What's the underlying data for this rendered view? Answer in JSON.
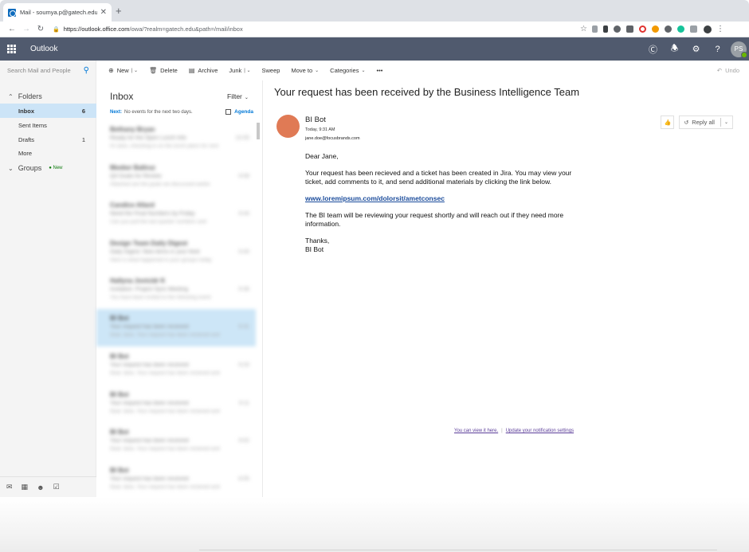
{
  "browser": {
    "tab_title": "Mail - soumya.p@gatech.edu",
    "tab_close": "✕",
    "new_tab": "+",
    "url_host": "https://outlook.office.com",
    "url_path": "/owa/?realm=gatech.edu&path=/mail/inbox"
  },
  "header": {
    "brand": "Outlook",
    "avatar_initials": "PS"
  },
  "leftnav": {
    "search_placeholder": "Search Mail and People",
    "folders_label": "Folders",
    "folders": [
      {
        "name": "Inbox",
        "count": "6"
      },
      {
        "name": "Sent Items",
        "count": ""
      },
      {
        "name": "Drafts",
        "count": "1"
      },
      {
        "name": "More",
        "count": ""
      }
    ],
    "groups_label": "Groups",
    "groups_badge": "New"
  },
  "commandbar": {
    "new": "New",
    "delete": "Delete",
    "archive": "Archive",
    "junk": "Junk",
    "sweep": "Sweep",
    "move_to": "Move to",
    "categories": "Categories",
    "more": "•••",
    "undo": "Undo"
  },
  "list": {
    "title": "Inbox",
    "filter": "Filter",
    "next_label": "Next:",
    "next_text": "No events for the next two days.",
    "agenda": "Agenda",
    "items": [
      {
        "from": "Bethany Bryan",
        "subject": "Ready for the Open Lunch Info",
        "time": "10:05",
        "preview": "Hi Jane, checking in on the lunch plans for next"
      },
      {
        "from": "Meeker Baltruz",
        "subject": "Q4 Goals for Review",
        "time": "9:58",
        "preview": "Attached are the goals we discussed earlier"
      },
      {
        "from": "Candice Allard",
        "subject": "Need the Final Numbers by Friday",
        "time": "9:44",
        "preview": "Can you pull the last quarter numbers and"
      },
      {
        "from": "Design Team Daily Digest",
        "subject": "Daily Digest: New items in your feed",
        "time": "9:40",
        "preview": "Here is what happened in your groups today"
      },
      {
        "from": "Hallyna Jovicidr K",
        "subject": "Invitation: Project Sync Meeting",
        "time": "9:36",
        "preview": "You have been invited to the following event"
      },
      {
        "from": "BI Bot",
        "subject": "Your request has been received",
        "time": "9:31",
        "preview": "Dear Jane, Your request has been recieved and"
      },
      {
        "from": "BI Bot",
        "subject": "Your request has been received",
        "time": "9:20",
        "preview": "Dear Jane, Your request has been recieved and"
      },
      {
        "from": "BI Bot",
        "subject": "Your request has been received",
        "time": "9:11",
        "preview": "Dear Jane, Your request has been recieved and"
      },
      {
        "from": "BI Bot",
        "subject": "Your request has been received",
        "time": "9:02",
        "preview": "Dear Jane, Your request has been recieved and"
      },
      {
        "from": "BI Bot",
        "subject": "Your request has been received",
        "time": "8:55",
        "preview": "Dear Jane, Your request has been recieved and"
      }
    ]
  },
  "message": {
    "subject": "Your request has been received by the Business Intelligence Team",
    "sender_name": "BI Bot",
    "sent_time": "Today, 9:31 AM",
    "sender_email": "jane.doe@focusbrands.com",
    "reply_all": "Reply all",
    "greeting": "Dear Jane,",
    "paragraph1": "Your request has been recieved and a ticket has been created in Jira. You may view your ticket, add comments to it, and send additional materials by clicking the link below.",
    "link": "www.loremipsum.com/dolorsit/ametconsec",
    "paragraph2": "The BI team will be reviewing your request shortly and will reach out if they need more information.",
    "closing": "Thanks,",
    "signature": "BI Bot",
    "footer_link1": "You can view it here.",
    "footer_link2": "Update your notification settings"
  },
  "colors": {
    "header_bg": "#505a6e",
    "accent": "#0078d7",
    "selected_folder": "#cce4f7",
    "sender_avatar": "#e07a55"
  }
}
